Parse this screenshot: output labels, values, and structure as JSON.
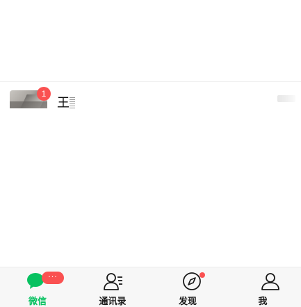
{
  "chat_list": [
    {
      "name": "王",
      "unread": "1"
    }
  ],
  "tabbar": {
    "chats": {
      "label": "微信",
      "badge": "···"
    },
    "contacts": {
      "label": "通讯录"
    },
    "discover": {
      "label": "发现"
    },
    "me": {
      "label": "我"
    }
  },
  "colors": {
    "accent": "#07c160",
    "badge": "#fa5151",
    "tabbar_bg": "#f7f7f7"
  }
}
